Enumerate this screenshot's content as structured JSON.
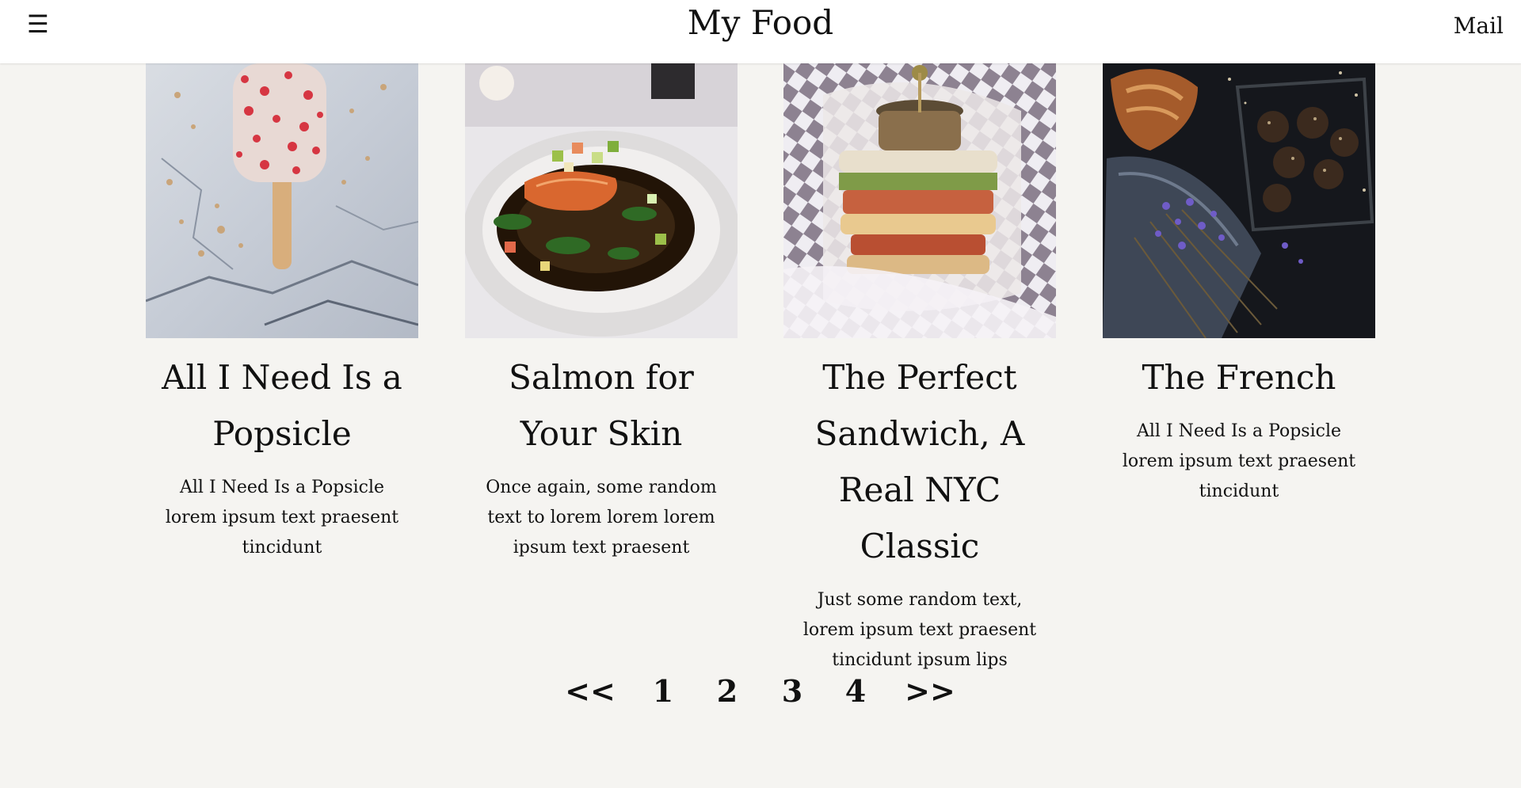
{
  "header": {
    "menu_glyph": "☰",
    "title": "My Food",
    "mail_label": "Mail"
  },
  "cards": [
    {
      "title": "All I Need Is a Popsicle",
      "text": "All I Need Is a Popsicle lorem ipsum text praesent tincidunt",
      "image": "popsicle-photo"
    },
    {
      "title": "Salmon for Your Skin",
      "text": "Once again, some random text to lorem lorem lorem ipsum text praesent",
      "image": "salmon-photo"
    },
    {
      "title": "The Perfect Sandwich, A Real NYC Classic",
      "text": "Just some random text, lorem ipsum text praesent tincidunt ipsum lips",
      "image": "sandwich-photo"
    },
    {
      "title": "The French",
      "text": "All I Need Is a Popsicle lorem ipsum text praesent tincidunt",
      "image": "croissant-photo"
    }
  ],
  "pagination": {
    "prev": "<<",
    "pages": [
      "1",
      "2",
      "3",
      "4"
    ],
    "next": ">>"
  },
  "colors": {
    "background": "#f5f4f1",
    "header": "#ffffff",
    "text": "#111111"
  }
}
